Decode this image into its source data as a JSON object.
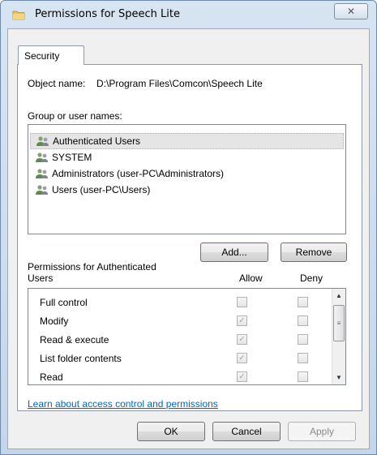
{
  "window": {
    "title": "Permissions for Speech Lite",
    "close_glyph": "✕"
  },
  "tabs": [
    {
      "label": "Security",
      "active": true
    }
  ],
  "object": {
    "label": "Object name:",
    "value": "D:\\Program Files\\Comcon\\Speech Lite"
  },
  "group": {
    "label": "Group or user names:",
    "users": [
      {
        "name": "Authenticated Users",
        "selected": true,
        "icon": "users-group-icon"
      },
      {
        "name": "SYSTEM",
        "selected": false,
        "icon": "users-group-icon"
      },
      {
        "name": "Administrators (user-PC\\Administrators)",
        "selected": false,
        "icon": "users-group-icon"
      },
      {
        "name": "Users (user-PC\\Users)",
        "selected": false,
        "icon": "users-group-icon"
      }
    ]
  },
  "buttons": {
    "add": "Add...",
    "remove": "Remove",
    "ok": "OK",
    "cancel": "Cancel",
    "apply": "Apply"
  },
  "permissions": {
    "label": "Permissions for Authenticated Users",
    "allow_header": "Allow",
    "deny_header": "Deny",
    "items": [
      {
        "name": "Full control",
        "allow": false,
        "deny": false
      },
      {
        "name": "Modify",
        "allow": true,
        "deny": false
      },
      {
        "name": "Read & execute",
        "allow": true,
        "deny": false
      },
      {
        "name": "List folder contents",
        "allow": true,
        "deny": false
      },
      {
        "name": "Read",
        "allow": true,
        "deny": false
      }
    ]
  },
  "link": "Learn about access control and permissions",
  "colors": {
    "link": "#0066cc",
    "selection": "#e5e5e5",
    "titlebar": "#d7e4f2"
  }
}
